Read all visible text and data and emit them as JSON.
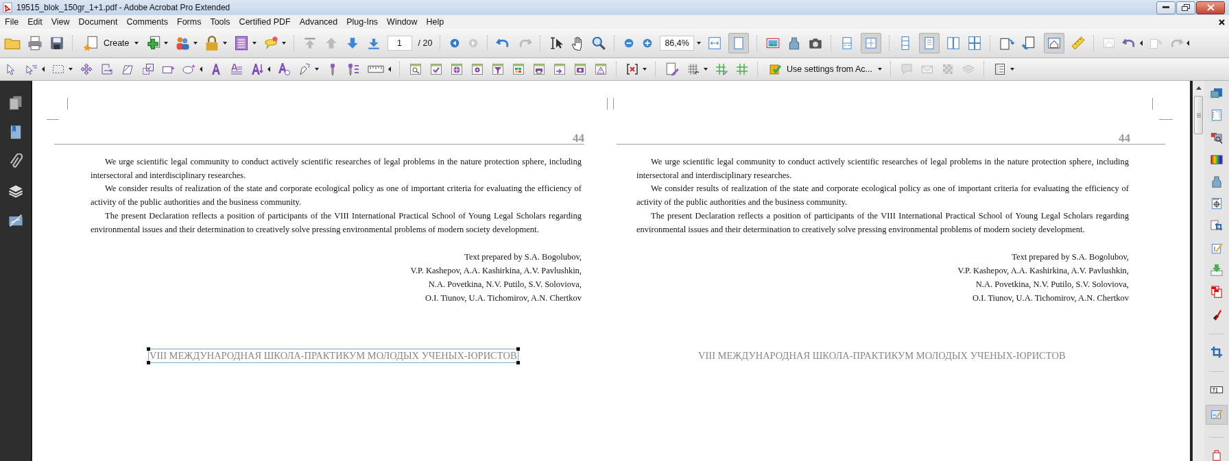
{
  "window": {
    "title": "19515_blok_150gr_1+1.pdf - Adobe Acrobat Pro Extended"
  },
  "menu": [
    "File",
    "Edit",
    "View",
    "Document",
    "Comments",
    "Forms",
    "Tools",
    "Certified PDF",
    "Advanced",
    "Plug-Ins",
    "Window",
    "Help"
  ],
  "toolbar": {
    "create": "Create",
    "page_number": "1",
    "page_total": "/ 20",
    "zoom": "86,4%"
  },
  "toolbar_2": {
    "preflight_profile": "Use settings from Ac..."
  },
  "pages": [
    {
      "page_number": "44",
      "paragraphs": [
        "We urge scientific legal community to conduct actively scientific researches of legal problems in the nature protection sphere, including intersectoral and interdisciplinary researches.",
        "We consider results of realization of the state and corporate ecological policy as one of important criteria for evaluating the efficiency of activity of the public authorities and the business community.",
        "The present Declaration reflects a position of participants of the VIII International Practical School of Young Legal Scholars regarding environmental issues and their determination to creatively solve pressing environmental problems of modern society development."
      ],
      "signature": [
        "Text prepared by S.A. Bogolubov,",
        "V.P. Kashepov, A.A. Kashirkina, A.V. Pavlushkin,",
        "N.A. Povetkina, N.V. Putilo, S.V. Soloviova,",
        "O.I. Tiunov, U.A. Tichomirov, A.N. Chertkov"
      ],
      "footer": "VIII МЕЖДУНАРОДНАЯ ШКОЛА-ПРАКТИКУМ МОЛОДЫХ УЧЕНЫХ-ЮРИСТОВ",
      "footer_selected": true
    },
    {
      "page_number": "44",
      "paragraphs": [
        "We urge scientific legal community to conduct actively scientific researches of legal problems in the nature protection sphere, including intersectoral and interdisciplinary researches.",
        "We consider results of realization of the state and corporate ecological policy as one of important criteria for evaluating the efficiency of activity of the public authorities and the business community.",
        "The present Declaration reflects a position of participants of the VIII International Practical School of Young Legal Scholars regarding environmental issues and their determination to creatively solve pressing environmental problems of modern society development."
      ],
      "signature": [
        "Text prepared by S.A. Bogolubov,",
        "V.P. Kashepov, A.A. Kashirkina, A.V. Pavlushkin,",
        "N.A. Povetkina, N.V. Putilo, S.V. Soloviova,",
        "O.I. Tiunov, U.A. Tichomirov, A.N. Chertkov"
      ],
      "footer": "VIII МЕЖДУНАРОДНАЯ ШКОЛА-ПРАКТИКУМ МОЛОДЫХ УЧЕНЫХ-ЮРИСТОВ",
      "footer_selected": false
    }
  ]
}
